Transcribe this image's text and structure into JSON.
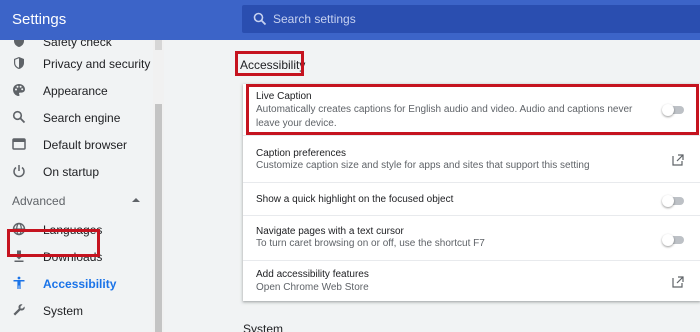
{
  "header": {
    "title": "Settings",
    "search_placeholder": "Search settings",
    "search_icon": "search-icon"
  },
  "sidebar": {
    "items": [
      {
        "label": "Safety check",
        "icon": "shield-check-icon"
      },
      {
        "label": "Privacy and security",
        "icon": "shield-icon"
      },
      {
        "label": "Appearance",
        "icon": "palette-icon"
      },
      {
        "label": "Search engine",
        "icon": "search-icon"
      },
      {
        "label": "Default browser",
        "icon": "browser-icon"
      },
      {
        "label": "On startup",
        "icon": "power-icon"
      }
    ],
    "advanced_label": "Advanced",
    "advanced_items": [
      {
        "label": "Languages",
        "icon": "globe-icon"
      },
      {
        "label": "Downloads",
        "icon": "download-icon"
      },
      {
        "label": "Accessibility",
        "icon": "accessibility-icon",
        "selected": true
      },
      {
        "label": "System",
        "icon": "wrench-icon"
      }
    ],
    "accent_color": "#1a73e8"
  },
  "main": {
    "section_title": "Accessibility",
    "rows": [
      {
        "title": "Live Caption",
        "subtitle": "Automatically creates captions for English audio and video. Audio and captions never leave your device.",
        "control": "toggle",
        "enabled": false
      },
      {
        "title": "Caption preferences",
        "subtitle": "Customize caption size and style for apps and sites that support this setting",
        "control": "external-link"
      },
      {
        "title": "Show a quick highlight on the focused object",
        "control": "toggle",
        "enabled": false
      },
      {
        "title": "Navigate pages with a text cursor",
        "subtitle": "To turn caret browsing on or off, use the shortcut F7",
        "control": "toggle",
        "enabled": false
      },
      {
        "title": "Add accessibility features",
        "subtitle": "Open Chrome Web Store",
        "control": "external-link"
      }
    ],
    "next_section_title": "System",
    "highlight_color": "#c5131f"
  }
}
